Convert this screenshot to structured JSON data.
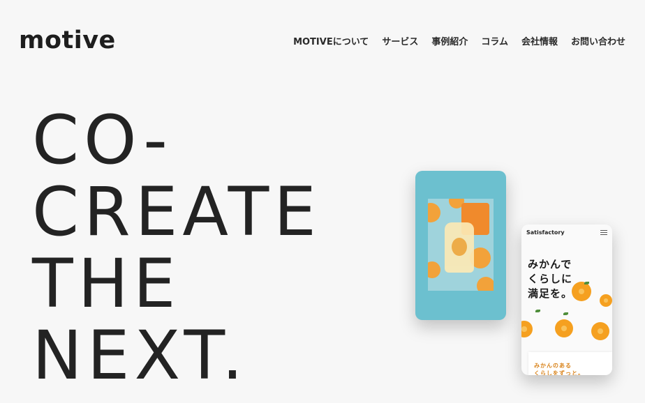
{
  "header": {
    "logo": "motive",
    "nav": [
      {
        "label": "MOTIVEについて"
      },
      {
        "label": "サービス"
      },
      {
        "label": "事例紹介"
      },
      {
        "label": "コラム"
      },
      {
        "label": "会社情報"
      },
      {
        "label": "お問い合わせ"
      }
    ]
  },
  "hero": {
    "lines": [
      "CO-",
      "CREATE",
      "THE",
      "NEXT."
    ]
  },
  "mockups": {
    "phone2": {
      "brand": "Satisfactory",
      "title_lines": [
        "みかんで",
        "くらしに",
        "満足を。"
      ],
      "card_lines": [
        "みかんのある",
        "くらしをずっと。"
      ]
    }
  },
  "colors": {
    "background": "#f7f7f7",
    "phone1_bg": "#6cc0cf",
    "accent_orange": "#f5a020"
  }
}
